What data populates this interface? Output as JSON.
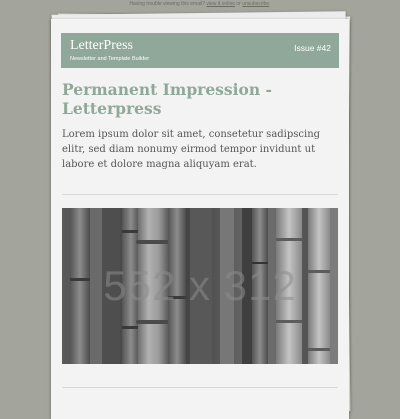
{
  "preheader": {
    "text": "Having trouble viewing this email? ",
    "online_link": "view it online",
    "or": " or ",
    "unsubscribe_link": "unsubscribe",
    "end": "."
  },
  "header": {
    "brand": "LetterPress",
    "tagline": "Newsletter and Template Builder",
    "issue": "Issue #42",
    "background_color": "#8fa899"
  },
  "article": {
    "title": "Permanent Impression - Letterpress",
    "intro": "Lorem ipsum dolor sit amet, consetetur sadipscing elitr, sed diam nonumy eirmod tempor invidunt ut labore et dolore magna aliquyam erat.",
    "title_color": "#8fa899"
  },
  "hero_image": {
    "placeholder_text": "552 x 312",
    "subject": "bamboo stalks, grayscale"
  },
  "colors": {
    "page_background": "#a3a49b",
    "card_background": "#f3f3f3",
    "body_text": "#555555"
  }
}
